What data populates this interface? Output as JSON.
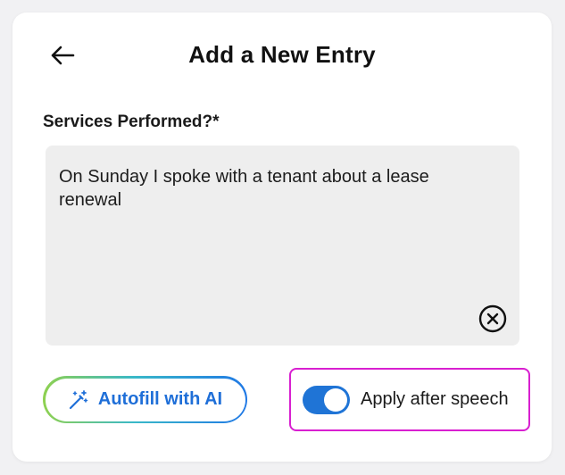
{
  "header": {
    "back_icon": "arrow-left-icon",
    "title": "Add a New Entry"
  },
  "form": {
    "field_label": "Services Performed?*",
    "textarea_value": "On Sunday I spoke with a tenant about a lease renewal",
    "clear_icon": "clear-circle-x-icon"
  },
  "actions": {
    "autofill_label": "Autofill with AI",
    "autofill_icon": "magic-wand-icon",
    "autofill_gradient": [
      "#8fd14f",
      "#39b8c9",
      "#1f78e5"
    ],
    "toggle_label": "Apply after speech",
    "toggle_on": true,
    "toggle_color": "#1f74d6",
    "highlight_border_color": "#d81fd0"
  }
}
